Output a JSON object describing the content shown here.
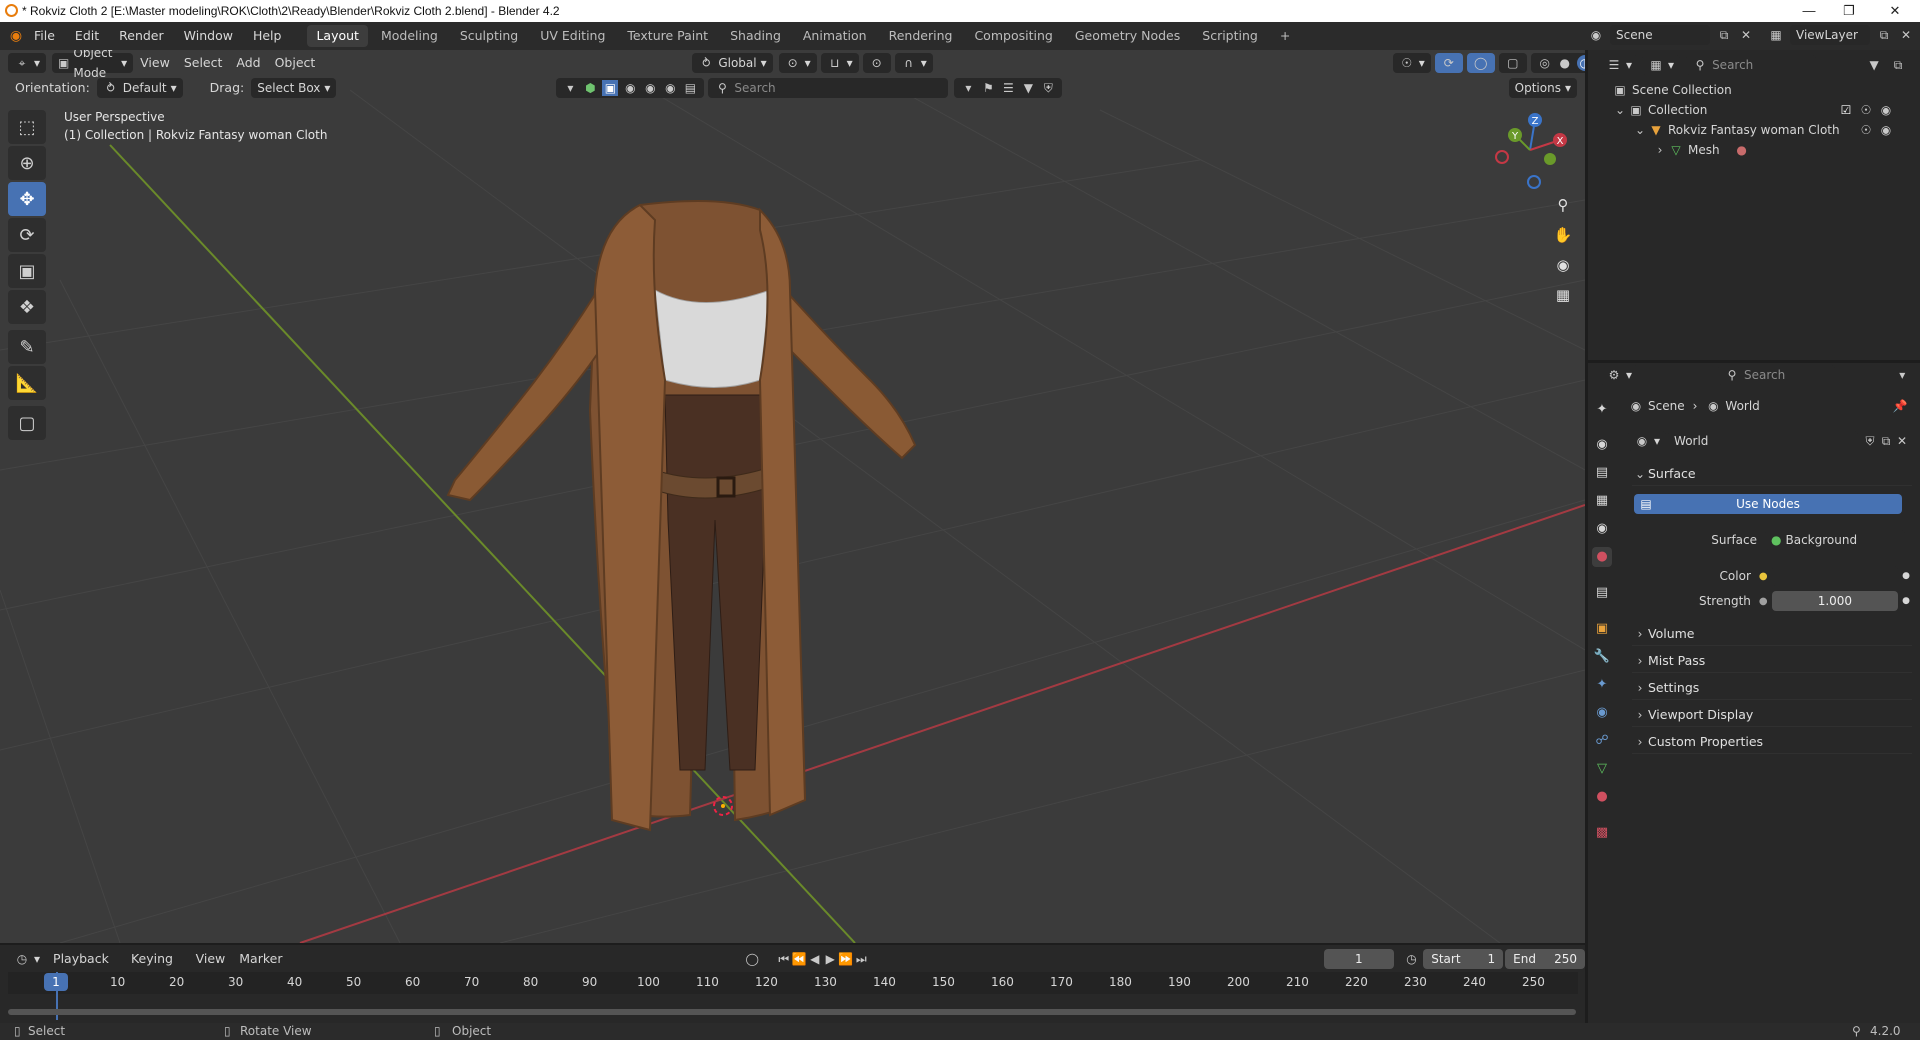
{
  "title_bar": {
    "title": "* Rokviz Cloth 2 [E:\\Master modeling\\ROK\\Cloth\\2\\Ready\\Blender\\Rokviz Cloth 2.blend] - Blender 4.2",
    "minimize": "—",
    "maximize": "❐",
    "close": "✕"
  },
  "menu": {
    "file": "File",
    "edit": "Edit",
    "render": "Render",
    "window": "Window",
    "help": "Help"
  },
  "workspaces": [
    "Layout",
    "Modeling",
    "Sculpting",
    "UV Editing",
    "Texture Paint",
    "Shading",
    "Animation",
    "Rendering",
    "Compositing",
    "Geometry Nodes",
    "Scripting"
  ],
  "workspace_add": "+",
  "scene": {
    "label": "Scene",
    "view_layer": "ViewLayer"
  },
  "viewport_header": {
    "mode": "Object Mode",
    "view": "View",
    "select": "Select",
    "add": "Add",
    "object": "Object",
    "transform": "Global",
    "orientation_label": "Orientation:",
    "orientation_value": "Default",
    "drag_label": "Drag:",
    "drag_value": "Select Box",
    "search_placeholder": "Search",
    "options": "Options"
  },
  "viewport_overlay": {
    "perspective": "User Perspective",
    "collection_info": "(1) Collection | Rokviz Fantasy woman Cloth"
  },
  "gizmo": {
    "z": "Z",
    "y": "Y",
    "x": "X"
  },
  "outliner": {
    "search_placeholder": "Search",
    "scene_collection": "Scene Collection",
    "collection": "Collection",
    "object": "Rokviz Fantasy woman Cloth",
    "mesh": "Mesh"
  },
  "properties": {
    "search_placeholder": "Search",
    "breadcrumb_scene": "Scene",
    "breadcrumb_world": "World",
    "world_name": "World",
    "surface_panel": "Surface",
    "use_nodes": "Use Nodes",
    "surface_label": "Surface",
    "surface_value": "Background",
    "color_label": "Color",
    "strength_label": "Strength",
    "strength_value": "1.000",
    "panels": [
      "Volume",
      "Mist Pass",
      "Settings",
      "Viewport Display",
      "Custom Properties"
    ]
  },
  "timeline": {
    "playback": "Playback",
    "keying": "Keying",
    "view": "View",
    "marker": "Marker",
    "current_frame": "1",
    "start_label": "Start",
    "start_value": "1",
    "end_label": "End",
    "end_value": "250",
    "ruler": [
      "1",
      "10",
      "20",
      "30",
      "40",
      "50",
      "60",
      "70",
      "80",
      "90",
      "100",
      "110",
      "120",
      "130",
      "140",
      "150",
      "160",
      "170",
      "180",
      "190",
      "200",
      "210",
      "220",
      "230",
      "240",
      "250"
    ]
  },
  "statusbar": {
    "select": "Select",
    "rotate": "Rotate View",
    "object": "Object",
    "version": "4.2.0"
  },
  "colors": {
    "accent": "#4772b3",
    "grid_x": "#a33a42",
    "grid_y": "#6a8a2a",
    "coat": "#8a5a34",
    "viewport_bg": "#3b3b3b"
  }
}
